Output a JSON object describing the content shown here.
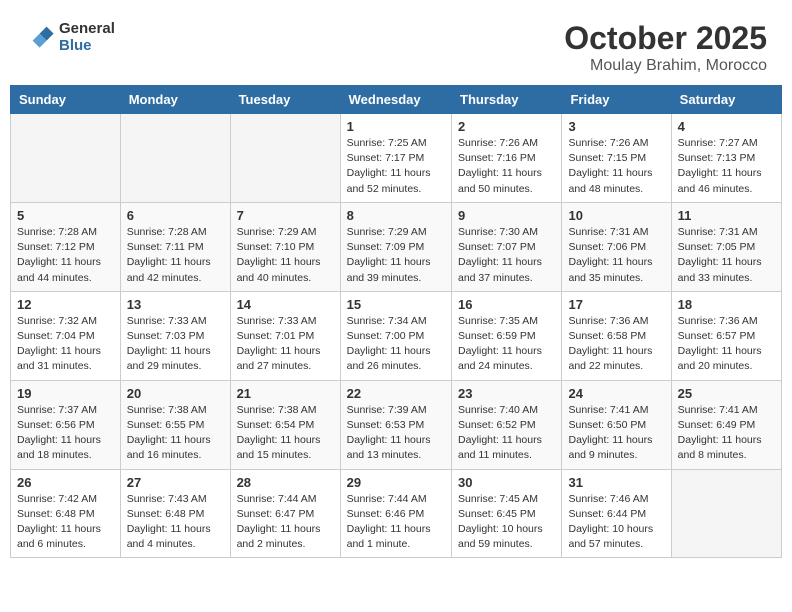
{
  "header": {
    "logo_line1": "General",
    "logo_line2": "Blue",
    "month": "October 2025",
    "location": "Moulay Brahim, Morocco"
  },
  "weekdays": [
    "Sunday",
    "Monday",
    "Tuesday",
    "Wednesday",
    "Thursday",
    "Friday",
    "Saturday"
  ],
  "weeks": [
    [
      {
        "day": "",
        "info": ""
      },
      {
        "day": "",
        "info": ""
      },
      {
        "day": "",
        "info": ""
      },
      {
        "day": "1",
        "info": "Sunrise: 7:25 AM\nSunset: 7:17 PM\nDaylight: 11 hours\nand 52 minutes."
      },
      {
        "day": "2",
        "info": "Sunrise: 7:26 AM\nSunset: 7:16 PM\nDaylight: 11 hours\nand 50 minutes."
      },
      {
        "day": "3",
        "info": "Sunrise: 7:26 AM\nSunset: 7:15 PM\nDaylight: 11 hours\nand 48 minutes."
      },
      {
        "day": "4",
        "info": "Sunrise: 7:27 AM\nSunset: 7:13 PM\nDaylight: 11 hours\nand 46 minutes."
      }
    ],
    [
      {
        "day": "5",
        "info": "Sunrise: 7:28 AM\nSunset: 7:12 PM\nDaylight: 11 hours\nand 44 minutes."
      },
      {
        "day": "6",
        "info": "Sunrise: 7:28 AM\nSunset: 7:11 PM\nDaylight: 11 hours\nand 42 minutes."
      },
      {
        "day": "7",
        "info": "Sunrise: 7:29 AM\nSunset: 7:10 PM\nDaylight: 11 hours\nand 40 minutes."
      },
      {
        "day": "8",
        "info": "Sunrise: 7:29 AM\nSunset: 7:09 PM\nDaylight: 11 hours\nand 39 minutes."
      },
      {
        "day": "9",
        "info": "Sunrise: 7:30 AM\nSunset: 7:07 PM\nDaylight: 11 hours\nand 37 minutes."
      },
      {
        "day": "10",
        "info": "Sunrise: 7:31 AM\nSunset: 7:06 PM\nDaylight: 11 hours\nand 35 minutes."
      },
      {
        "day": "11",
        "info": "Sunrise: 7:31 AM\nSunset: 7:05 PM\nDaylight: 11 hours\nand 33 minutes."
      }
    ],
    [
      {
        "day": "12",
        "info": "Sunrise: 7:32 AM\nSunset: 7:04 PM\nDaylight: 11 hours\nand 31 minutes."
      },
      {
        "day": "13",
        "info": "Sunrise: 7:33 AM\nSunset: 7:03 PM\nDaylight: 11 hours\nand 29 minutes."
      },
      {
        "day": "14",
        "info": "Sunrise: 7:33 AM\nSunset: 7:01 PM\nDaylight: 11 hours\nand 27 minutes."
      },
      {
        "day": "15",
        "info": "Sunrise: 7:34 AM\nSunset: 7:00 PM\nDaylight: 11 hours\nand 26 minutes."
      },
      {
        "day": "16",
        "info": "Sunrise: 7:35 AM\nSunset: 6:59 PM\nDaylight: 11 hours\nand 24 minutes."
      },
      {
        "day": "17",
        "info": "Sunrise: 7:36 AM\nSunset: 6:58 PM\nDaylight: 11 hours\nand 22 minutes."
      },
      {
        "day": "18",
        "info": "Sunrise: 7:36 AM\nSunset: 6:57 PM\nDaylight: 11 hours\nand 20 minutes."
      }
    ],
    [
      {
        "day": "19",
        "info": "Sunrise: 7:37 AM\nSunset: 6:56 PM\nDaylight: 11 hours\nand 18 minutes."
      },
      {
        "day": "20",
        "info": "Sunrise: 7:38 AM\nSunset: 6:55 PM\nDaylight: 11 hours\nand 16 minutes."
      },
      {
        "day": "21",
        "info": "Sunrise: 7:38 AM\nSunset: 6:54 PM\nDaylight: 11 hours\nand 15 minutes."
      },
      {
        "day": "22",
        "info": "Sunrise: 7:39 AM\nSunset: 6:53 PM\nDaylight: 11 hours\nand 13 minutes."
      },
      {
        "day": "23",
        "info": "Sunrise: 7:40 AM\nSunset: 6:52 PM\nDaylight: 11 hours\nand 11 minutes."
      },
      {
        "day": "24",
        "info": "Sunrise: 7:41 AM\nSunset: 6:50 PM\nDaylight: 11 hours\nand 9 minutes."
      },
      {
        "day": "25",
        "info": "Sunrise: 7:41 AM\nSunset: 6:49 PM\nDaylight: 11 hours\nand 8 minutes."
      }
    ],
    [
      {
        "day": "26",
        "info": "Sunrise: 7:42 AM\nSunset: 6:48 PM\nDaylight: 11 hours\nand 6 minutes."
      },
      {
        "day": "27",
        "info": "Sunrise: 7:43 AM\nSunset: 6:48 PM\nDaylight: 11 hours\nand 4 minutes."
      },
      {
        "day": "28",
        "info": "Sunrise: 7:44 AM\nSunset: 6:47 PM\nDaylight: 11 hours\nand 2 minutes."
      },
      {
        "day": "29",
        "info": "Sunrise: 7:44 AM\nSunset: 6:46 PM\nDaylight: 11 hours\nand 1 minute."
      },
      {
        "day": "30",
        "info": "Sunrise: 7:45 AM\nSunset: 6:45 PM\nDaylight: 10 hours\nand 59 minutes."
      },
      {
        "day": "31",
        "info": "Sunrise: 7:46 AM\nSunset: 6:44 PM\nDaylight: 10 hours\nand 57 minutes."
      },
      {
        "day": "",
        "info": ""
      }
    ]
  ]
}
